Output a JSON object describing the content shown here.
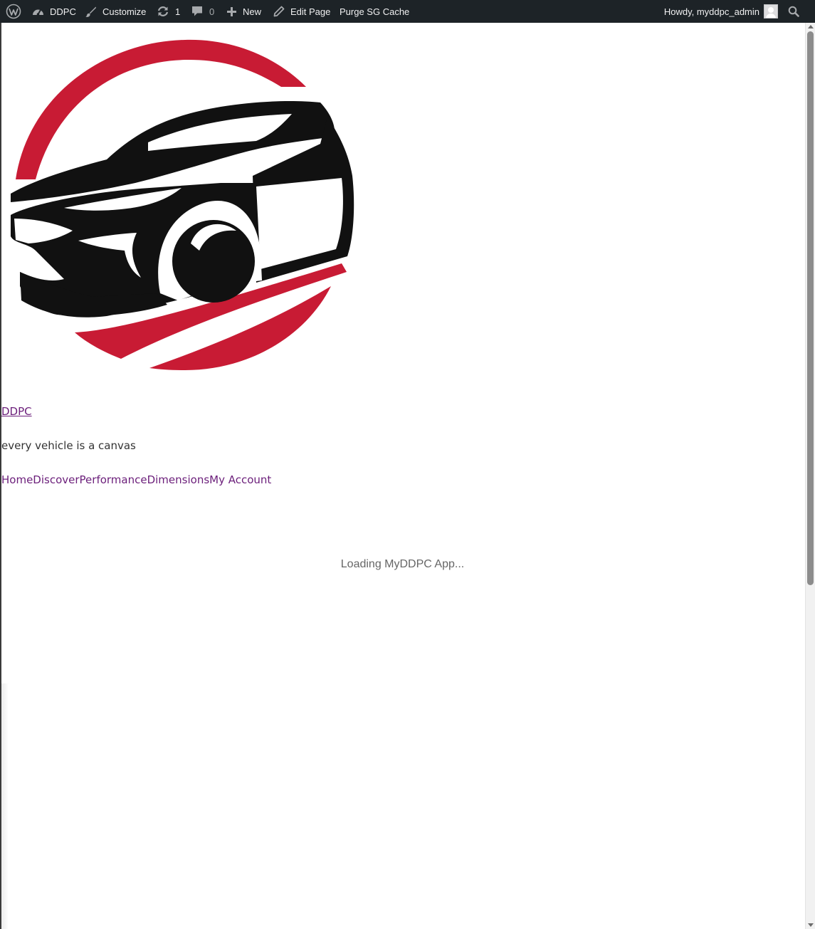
{
  "admin_bar": {
    "site_name": "DDPC",
    "customize_label": "Customize",
    "updates_count": "1",
    "comments_count": "0",
    "new_label": "New",
    "edit_page_label": "Edit Page",
    "purge_cache_label": "Purge SG Cache",
    "greeting": "Howdy, myddpc_admin"
  },
  "site": {
    "title": "DDPC",
    "tagline": "every vehicle is a canvas"
  },
  "nav": {
    "items": [
      {
        "label": "Home"
      },
      {
        "label": "Discover"
      },
      {
        "label": "Performance"
      },
      {
        "label": "Dimensions"
      },
      {
        "label": "My Account"
      }
    ]
  },
  "app": {
    "loading_text": "Loading MyDDPC App..."
  },
  "colors": {
    "admin_bar_bg": "#1d2327",
    "logo_red": "#c81b34",
    "logo_black": "#111111",
    "link_purple": "#6b1e7a"
  }
}
